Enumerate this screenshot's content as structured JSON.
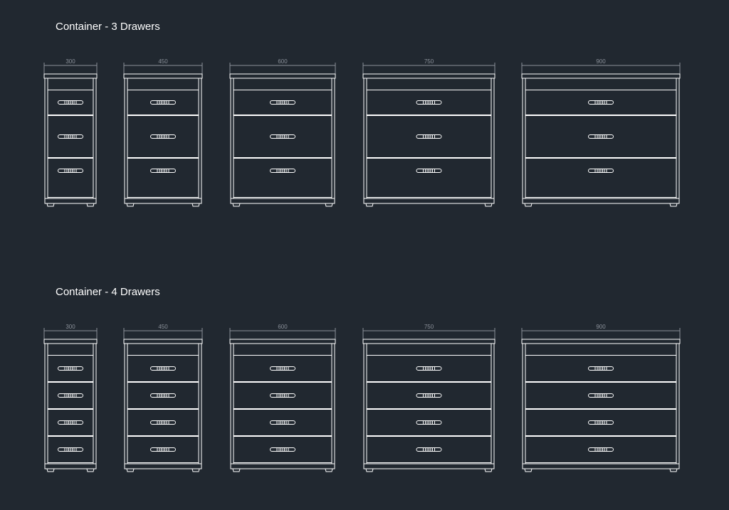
{
  "colors": {
    "background": "#212830",
    "outline": "#ffffff",
    "dimension": "#8a9099"
  },
  "sections": [
    {
      "title": "Container - 3 Drawers",
      "drawer_count": 3,
      "containers": [
        {
          "width_label": "300"
        },
        {
          "width_label": "450"
        },
        {
          "width_label": "600"
        },
        {
          "width_label": "750"
        },
        {
          "width_label": "900"
        }
      ]
    },
    {
      "title": "Container - 4 Drawers",
      "drawer_count": 4,
      "containers": [
        {
          "width_label": "300"
        },
        {
          "width_label": "450"
        },
        {
          "width_label": "600"
        },
        {
          "width_label": "750"
        },
        {
          "width_label": "900"
        }
      ]
    }
  ]
}
